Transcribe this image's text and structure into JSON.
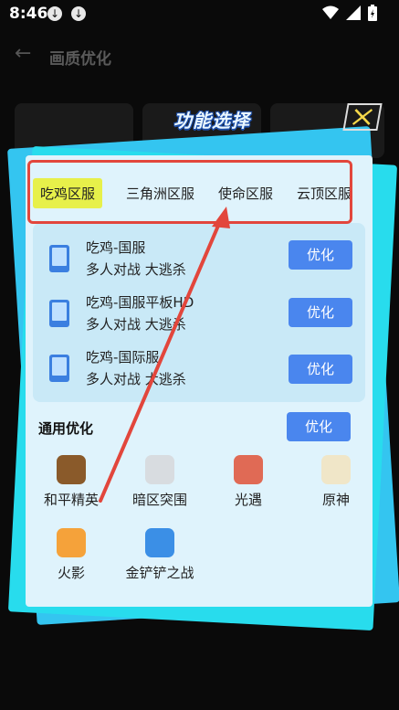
{
  "status_bar": {
    "time": "8:46"
  },
  "header": {
    "back_icon": "arrow-left-icon",
    "title": "画质优化"
  },
  "dialog": {
    "title": "功能选择",
    "tabs": [
      {
        "label": "吃鸡区服",
        "active": true
      },
      {
        "label": "三角洲区服"
      },
      {
        "label": "使命区服"
      },
      {
        "label": "云顶区服"
      }
    ],
    "servers": [
      {
        "name": "吃鸡-国服",
        "sub": "多人对战  大逃杀",
        "button": "优化"
      },
      {
        "name": "吃鸡-国服平板HD",
        "sub": "多人对战  大逃杀",
        "button": "优化"
      },
      {
        "name": "吃鸡-国际服",
        "sub": "多人对战  大逃杀",
        "button": "优化"
      }
    ],
    "general": {
      "title": "通用优化",
      "button": "优化",
      "games": [
        {
          "name": "和平精英",
          "color": "#8a5a2a"
        },
        {
          "name": "暗区突围",
          "color": "#d8dce0"
        },
        {
          "name": "光遇",
          "color": "#e06a55"
        },
        {
          "name": "原神",
          "color": "#f0e6c8"
        },
        {
          "name": "火影",
          "color": "#f5a23a"
        },
        {
          "name": "金铲铲之战",
          "color": "#3b8fe6"
        }
      ]
    }
  },
  "colors": {
    "accent_blue": "#4a86ee",
    "tab_highlight": "#e7f04a",
    "annotation_red": "#e2463c"
  }
}
